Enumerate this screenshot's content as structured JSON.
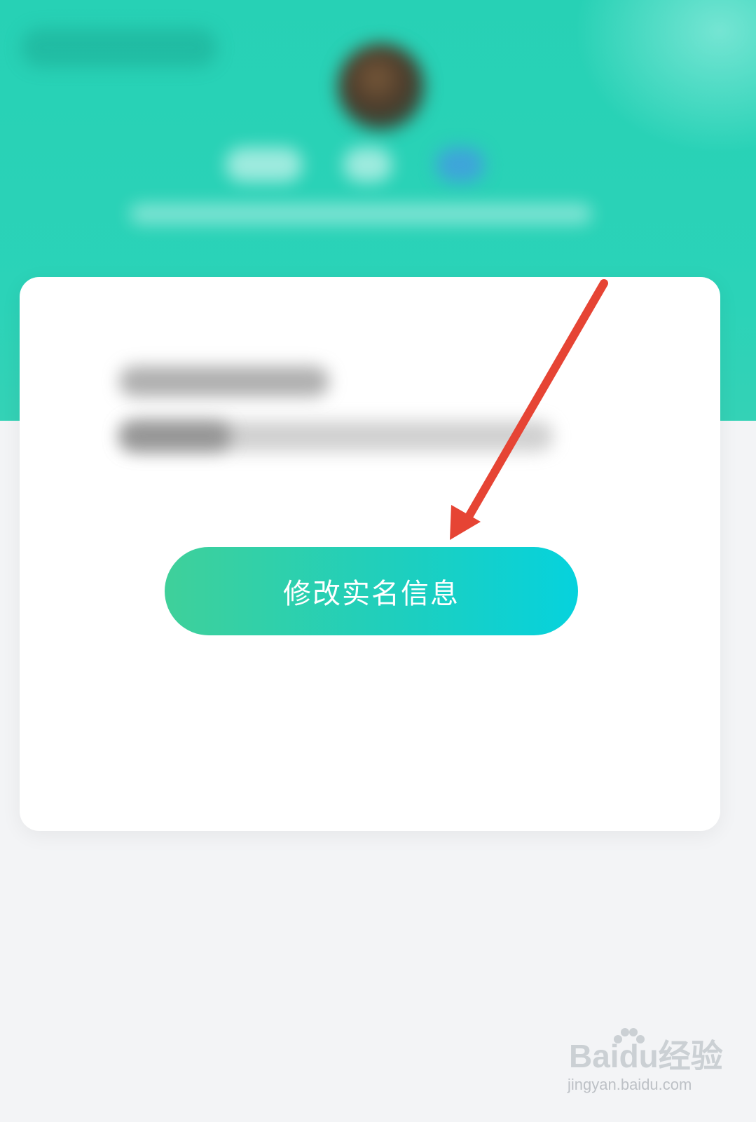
{
  "header": {
    "avatar_icon": "user-avatar",
    "colors": {
      "accent": "#2bd3b8"
    }
  },
  "card": {
    "action_button": {
      "label": "修改实名信息",
      "gradient": [
        "#3fd09a",
        "#06d2dd"
      ]
    }
  },
  "annotation": {
    "arrow_color": "#e64434"
  },
  "watermark": {
    "logo": "Baidu经验",
    "url": "jingyan.baidu.com"
  }
}
